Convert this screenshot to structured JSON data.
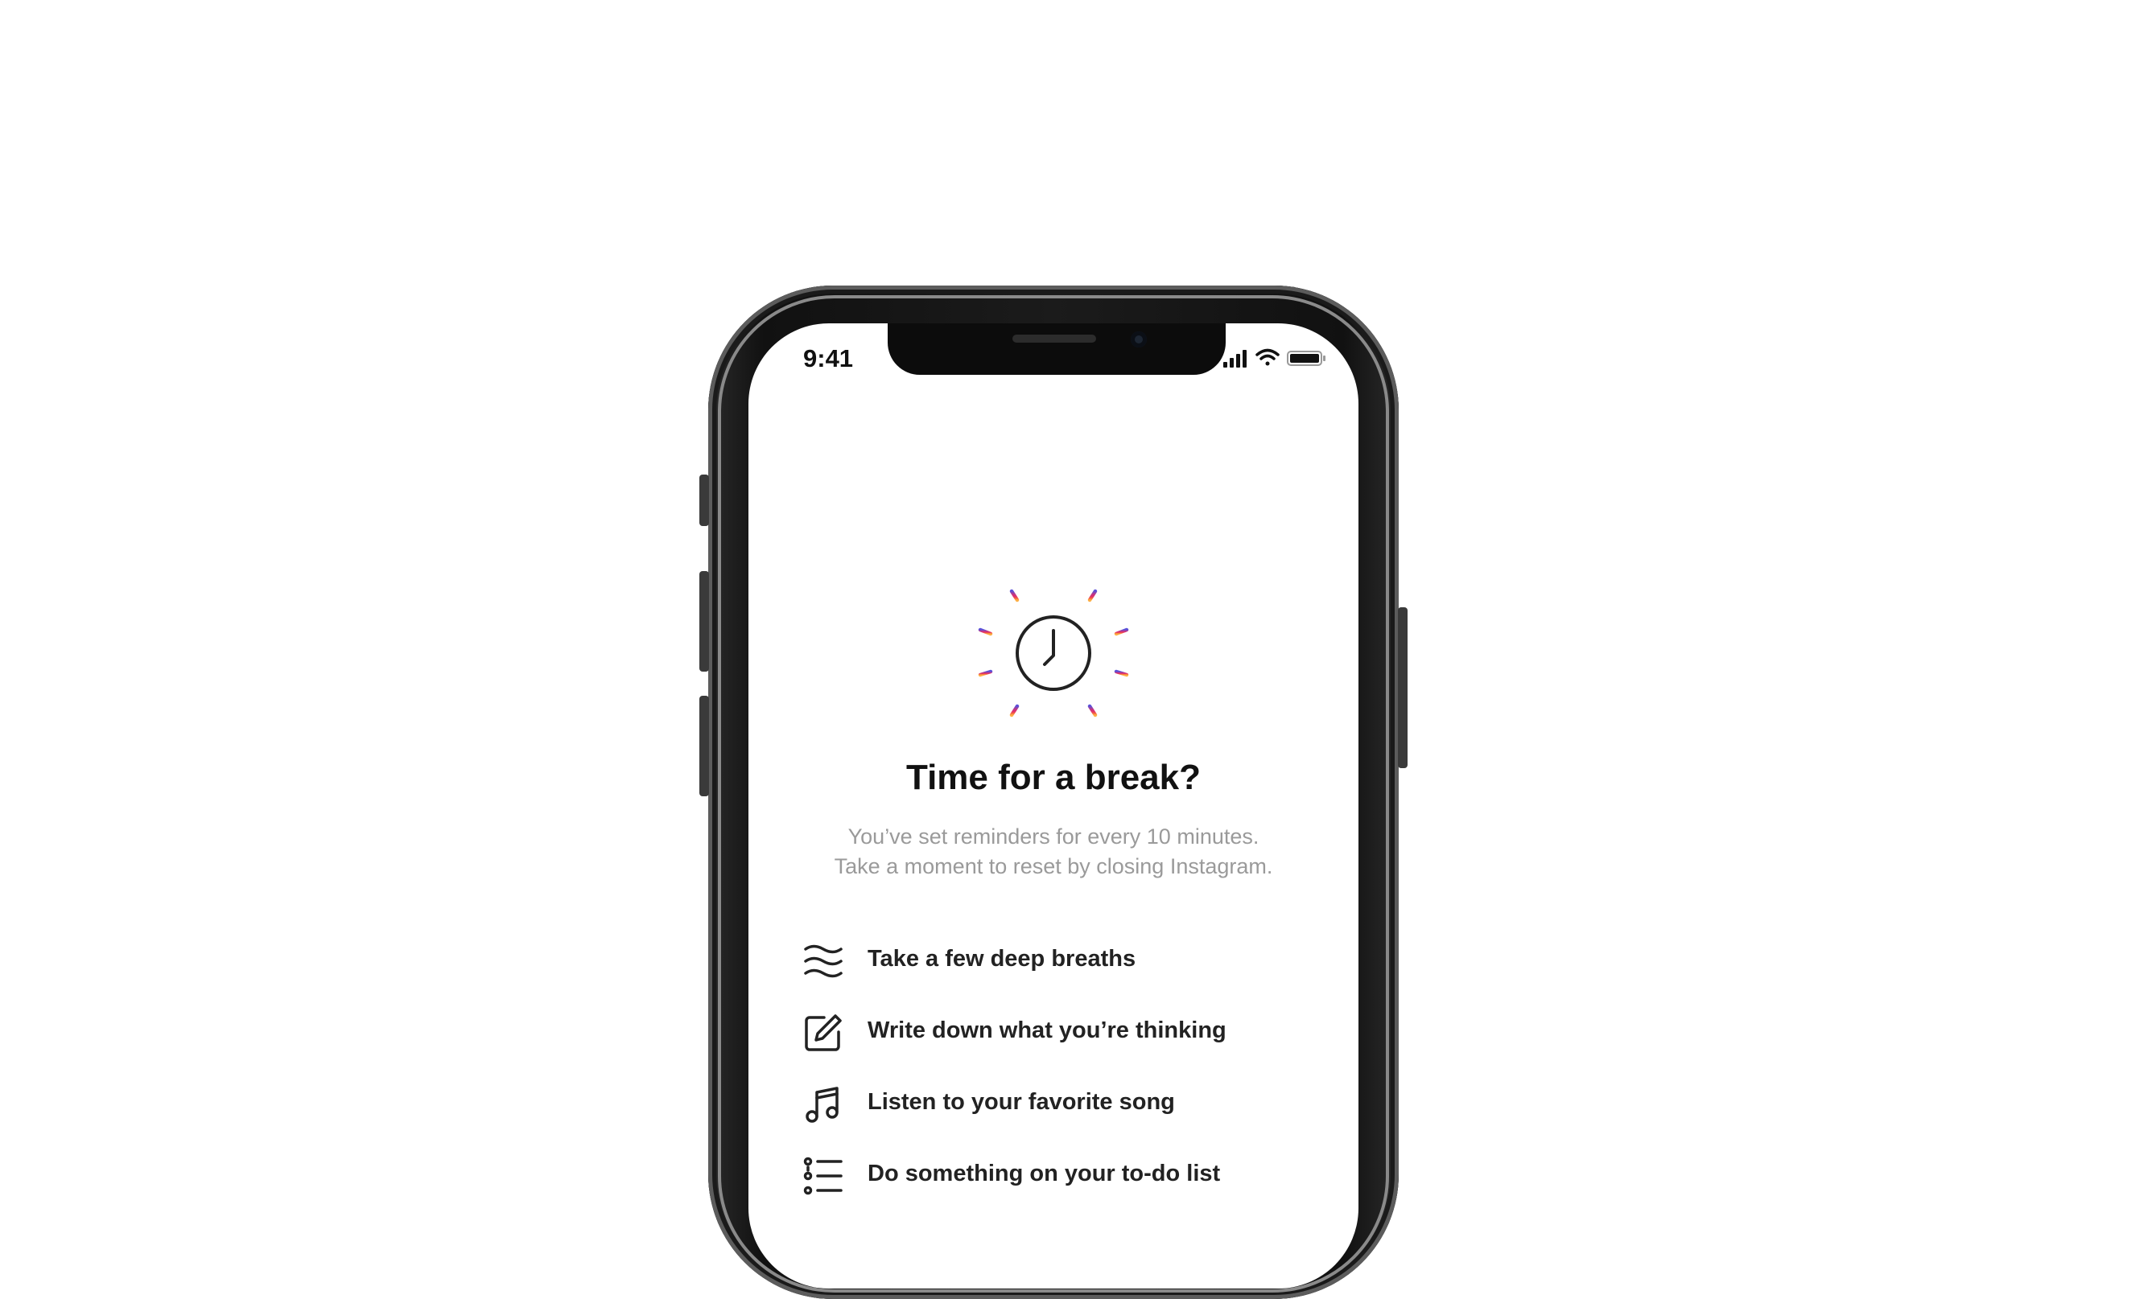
{
  "status_bar": {
    "time": "9:41",
    "icons": [
      "cellular-signal-icon",
      "wifi-icon",
      "battery-icon"
    ]
  },
  "break_screen": {
    "icon": "clock-with-rays-icon",
    "title": "Time for a break?",
    "subtitle_line1": "You’ve set reminders for every 10 minutes.",
    "subtitle_line2": "Take a moment to reset by closing Instagram.",
    "suggestions": [
      {
        "icon": "breath-waves-icon",
        "label": "Take a few deep breaths"
      },
      {
        "icon": "compose-pencil-icon",
        "label": "Write down what you’re thinking"
      },
      {
        "icon": "music-note-icon",
        "label": "Listen to your favorite song"
      },
      {
        "icon": "checklist-icon",
        "label": "Do something on your to-do list"
      }
    ]
  },
  "colors": {
    "title": "#111111",
    "subtitle": "#9a9a9a",
    "ray_gradient": [
      "#5b51d8",
      "#c13584",
      "#e1306c",
      "#f56040",
      "#fcaf45"
    ]
  }
}
